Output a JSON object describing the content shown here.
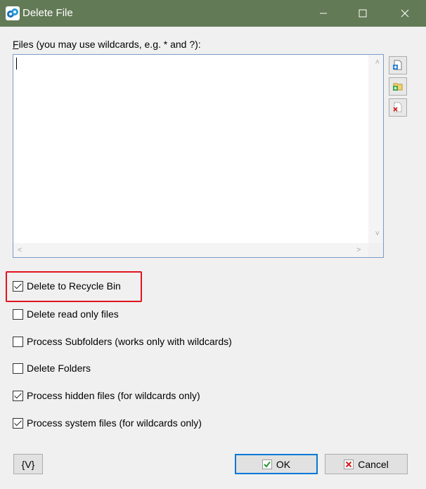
{
  "window": {
    "title": "Delete File"
  },
  "files": {
    "label_accel": "F",
    "label_rest": "iles (you may use wildcards, e.g. * and ?):",
    "value": ""
  },
  "tools": [
    {
      "icon": "add-file-icon"
    },
    {
      "icon": "add-folder-icon"
    },
    {
      "icon": "remove-file-icon"
    }
  ],
  "options": [
    {
      "label": "Delete to Recycle Bin",
      "checked": true
    },
    {
      "label": "Delete read only files",
      "checked": false
    },
    {
      "label": "Process Subfolders (works only with wildcards)",
      "checked": false
    },
    {
      "label": "Delete Folders",
      "checked": false
    },
    {
      "label": "Process hidden files (for wildcards only)",
      "checked": true
    },
    {
      "label": "Process system files (for wildcards only)",
      "checked": true
    }
  ],
  "buttons": {
    "variables": "{V}",
    "ok": "OK",
    "cancel": "Cancel"
  },
  "colors": {
    "titlebar": "#637a56",
    "highlight": "#e0141e",
    "focus": "#0078d7"
  }
}
